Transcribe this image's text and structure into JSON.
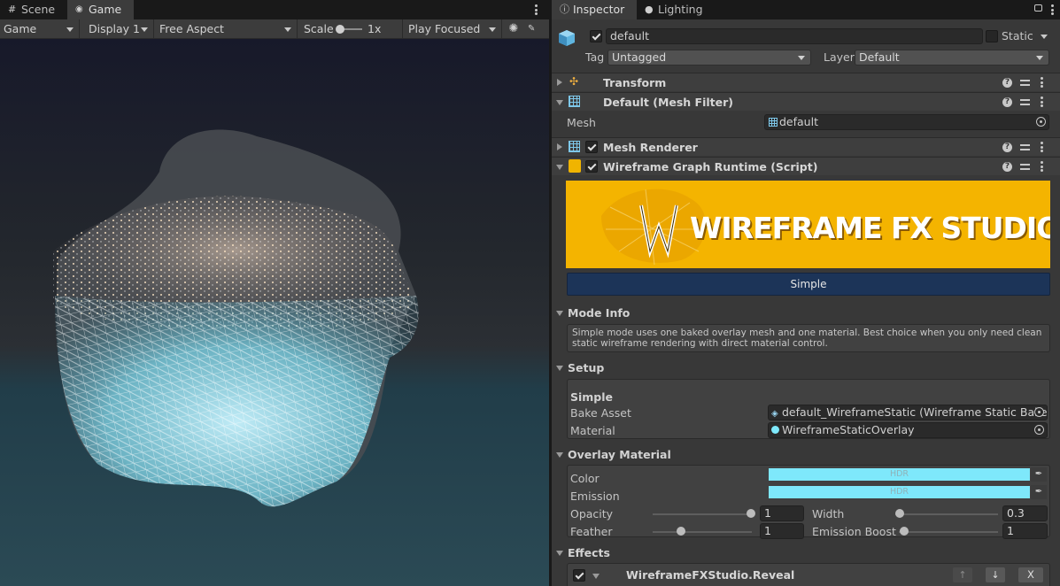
{
  "left_tabs": {
    "scene": "Scene",
    "game": "Game"
  },
  "game_toolbar": {
    "display_mode": "Game",
    "display": "Display 1",
    "aspect": "Free Aspect",
    "scale_label": "Scale",
    "scale_value": "1x",
    "play_mode": "Play Focused"
  },
  "right_tabs": {
    "inspector": "Inspector",
    "lighting": "Lighting"
  },
  "object": {
    "name": "default",
    "static_label": "Static",
    "tag_label": "Tag",
    "tag_value": "Untagged",
    "layer_label": "Layer",
    "layer_value": "Default"
  },
  "components": {
    "transform": "Transform",
    "mesh_filter": "Default (Mesh Filter)",
    "mesh_label": "Mesh",
    "mesh_value": "default",
    "mesh_renderer": "Mesh Renderer",
    "script": "Wireframe Graph Runtime (Script)"
  },
  "banner": {
    "title": "WIREFRAME FX STUDIO",
    "mode_button": "Simple"
  },
  "mode_info": {
    "header": "Mode Info",
    "text": "Simple mode uses one baked overlay mesh and one material. Best choice when you only need clean static wireframe rendering with direct material control."
  },
  "setup": {
    "header": "Setup",
    "sub": "Simple",
    "bake_label": "Bake Asset",
    "bake_value": "default_WireframeStatic (Wireframe Static Bake A",
    "material_label": "Material",
    "material_value": "WireframeStaticOverlay"
  },
  "overlay": {
    "header": "Overlay Material",
    "color_label": "Color",
    "emission_label": "Emission",
    "hdr": "HDR",
    "opacity_label": "Opacity",
    "opacity_value": "1",
    "opacity_fraction": 1.0,
    "width_label": "Width",
    "width_value": "0.3",
    "width_fraction": 0.0,
    "feather_label": "Feather",
    "feather_value": "1",
    "feather_fraction": 0.25,
    "emission_boost_label": "Emission Boost",
    "emission_boost_value": "1",
    "emission_boost_fraction": 0.05,
    "color_hex": "#7ee8fb"
  },
  "effects": {
    "header": "Effects",
    "item": "WireframeFXStudio.Reveal",
    "remove": "X"
  },
  "colors": {
    "accent": "#f4b400",
    "button": "#1c3458",
    "swatch": "#7ee8fb"
  }
}
